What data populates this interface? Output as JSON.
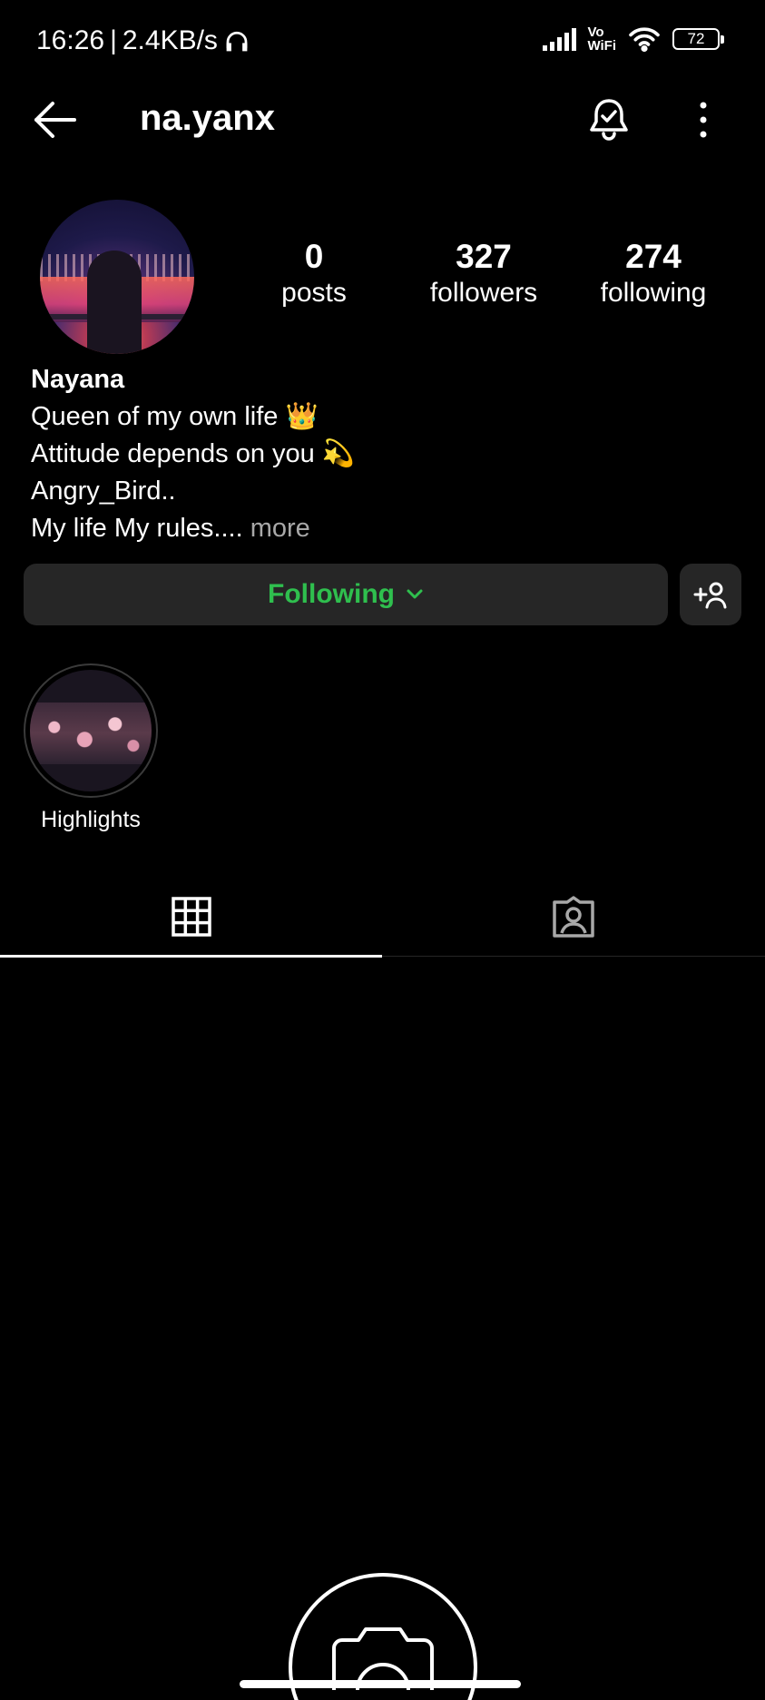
{
  "status_bar": {
    "time": "16:26",
    "speed": "2.4KB/s",
    "separator": "|",
    "vowifi_top": "Vo",
    "vowifi_bottom": "WiFi",
    "battery": "72"
  },
  "header": {
    "username": "na.yanx"
  },
  "profile": {
    "stats": [
      {
        "value": "0",
        "label": "posts"
      },
      {
        "value": "327",
        "label": "followers"
      },
      {
        "value": "274",
        "label": "following"
      }
    ],
    "name": "Nayana",
    "bio_lines": [
      "Queen of my own life 👑",
      "Attitude depends on you 💫",
      "Angry_Bird..",
      "My life My rules...."
    ],
    "more_label": "more"
  },
  "actions": {
    "following_label": "Following",
    "accent_color": "#2fbf4e"
  },
  "highlights": [
    {
      "label": "Highlights"
    }
  ],
  "tabs": [
    {
      "icon": "grid-icon",
      "active": true
    },
    {
      "icon": "tagged-icon",
      "active": false
    }
  ]
}
